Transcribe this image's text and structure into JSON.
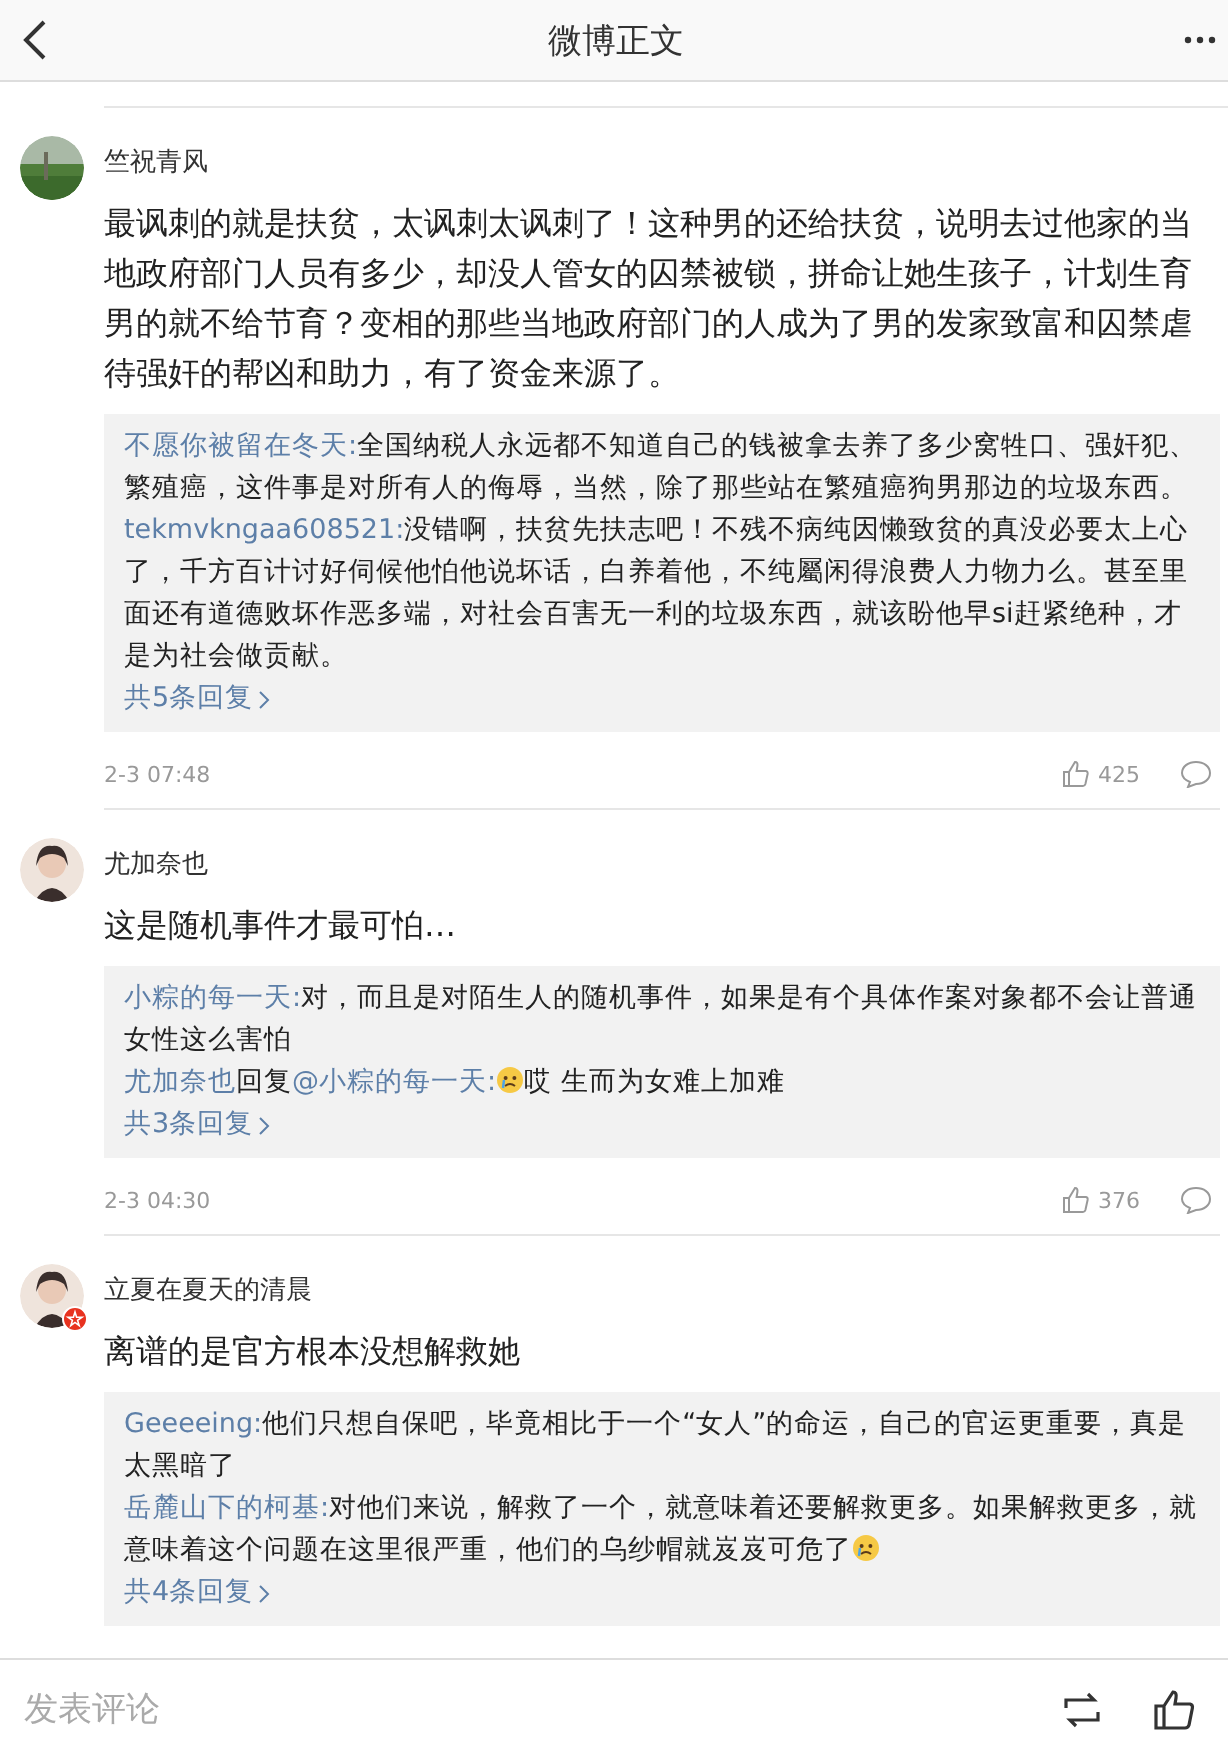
{
  "header": {
    "title": "微博正文"
  },
  "comments": [
    {
      "user": "竺祝青风",
      "avatar": {
        "kind": "picture"
      },
      "verified": false,
      "text": "最讽刺的就是扶贫，太讽刺太讽刺了！这种男的还给扶贫，说明去过他家的当地政府部门人员有多少，却没人管女的囚禁被锁，拼命让她生孩子，计划生育男的就不给节育？变相的那些当地政府部门的人成为了男的发家致富和囚禁虐待强奸的帮凶和助力，有了资金来源了。",
      "replies": [
        [
          {
            "kind": "user",
            "text": "不愿你被留在冬天:"
          },
          {
            "kind": "text",
            "text": "全国纳税人永远都不知道自己的钱被拿去养了多少窝牲口、强奸犯、繁殖癌，这件事是对所有人的侮辱，当然，除了那些站在繁殖癌狗男那边的垃圾东西。"
          }
        ],
        [
          {
            "kind": "user",
            "text": "tekmvkngaa608521:"
          },
          {
            "kind": "text",
            "text": "没错啊，扶贫先扶志吧！不残不病纯因懒致贫的真没必要太上心了，千方百计讨好伺候他怕他说坏话，白养着他，不纯屬闲得浪费人力物力么。甚至里面还有道德败坏作恶多端，对社会百害无一利的垃圾东西，就该盼他早si赶紧绝种，才是为社会做贡献。"
          }
        ]
      ],
      "more": "共5条回复",
      "time": "2-3 07:48",
      "likes": "425"
    },
    {
      "user": "尤加奈也",
      "avatar": {
        "kind": "picture"
      },
      "verified": false,
      "text": "这是随机事件才最可怕…",
      "replies": [
        [
          {
            "kind": "user",
            "text": "小粽的每一天:"
          },
          {
            "kind": "text",
            "text": "对，而且是对陌生人的随机事件，如果是有个具体作案对象都不会让普通女性这么害怕"
          }
        ],
        [
          {
            "kind": "user",
            "text": "尤加奈也"
          },
          {
            "kind": "text",
            "text": "回复"
          },
          {
            "kind": "user",
            "text": "@小粽的每一天:"
          },
          {
            "kind": "emoji"
          },
          {
            "kind": "text",
            "text": "哎 生而为女难上加难"
          }
        ]
      ],
      "more": "共3条回复",
      "time": "2-3 04:30",
      "likes": "376"
    },
    {
      "user": "立夏在夏天的清晨",
      "avatar": {
        "kind": "picture"
      },
      "verified": true,
      "text": "离谱的是官方根本没想解救她",
      "replies": [
        [
          {
            "kind": "user",
            "text": "Geeeeing:"
          },
          {
            "kind": "text",
            "text": "他们只想自保吧，毕竟相比于一个“女人”的命运，自己的官运更重要，真是太黑暗了"
          }
        ],
        [
          {
            "kind": "user",
            "text": "岳麓山下的柯基:"
          },
          {
            "kind": "text",
            "text": "对他们来说，解救了一个，就意味着还要解救更多。如果解救更多，就意味着这个问题在这里很严重，他们的乌纱帽就岌岌可危了"
          },
          {
            "kind": "emoji"
          }
        ]
      ],
      "more": "共4条回复"
    }
  ],
  "footer": {
    "placeholder": "发表评论"
  }
}
